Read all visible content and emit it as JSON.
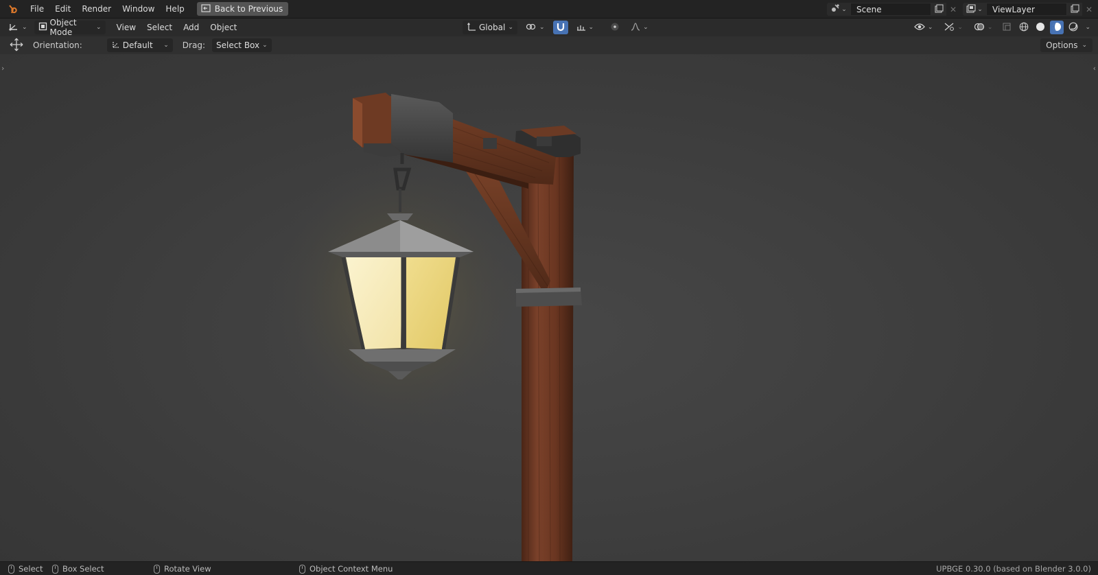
{
  "menubar": {
    "items": [
      "File",
      "Edit",
      "Render",
      "Window",
      "Help"
    ],
    "back_button": "Back to Previous",
    "scene_name": "Scene",
    "view_layer_name": "ViewLayer"
  },
  "header": {
    "mode": "Object Mode",
    "menus": [
      "View",
      "Select",
      "Add",
      "Object"
    ],
    "transform_orientation": "Global"
  },
  "tool_settings": {
    "orientation_label": "Orientation:",
    "orientation_value": "Default",
    "drag_label": "Drag:",
    "drag_value": "Select Box",
    "options_label": "Options"
  },
  "statusbar": {
    "select": "Select",
    "box_select": "Box Select",
    "rotate_view": "Rotate View",
    "context_menu": "Object Context Menu",
    "version": "UPBGE 0.30.0 (based on Blender 3.0.0)"
  },
  "colors": {
    "accent": "#4772b3",
    "lantern_glow": "#f5e9b8",
    "wood": "#6b3a24"
  }
}
